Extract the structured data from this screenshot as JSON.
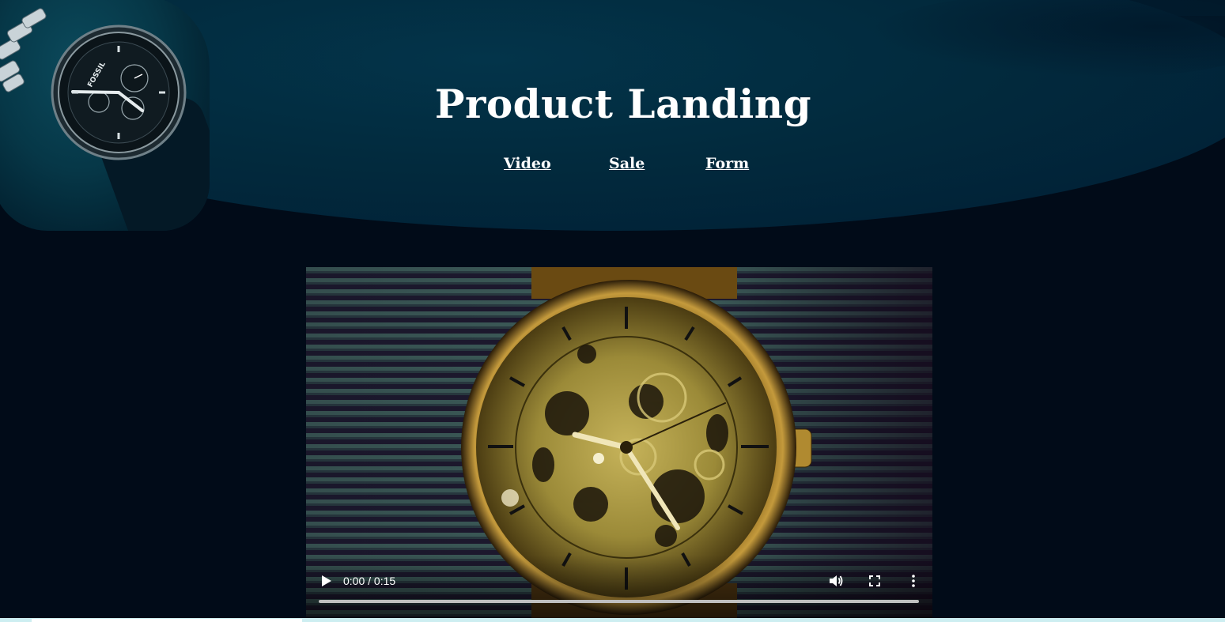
{
  "header": {
    "title": "Product Landing",
    "nav": [
      {
        "label": "Video"
      },
      {
        "label": "Sale"
      },
      {
        "label": "Form"
      }
    ],
    "logo_text": "FOSSIL"
  },
  "video": {
    "time_display": "0:00 / 0:15",
    "progress": 0,
    "icons": {
      "play": "play-icon",
      "volume": "volume-icon",
      "fullscreen": "fullscreen-icon",
      "more": "more-options-icon"
    }
  },
  "colors": {
    "page_bg": "#010b18",
    "header_bg": "#022a3d",
    "text": "#ffffff",
    "bottom_strip": "#cdeef1"
  }
}
